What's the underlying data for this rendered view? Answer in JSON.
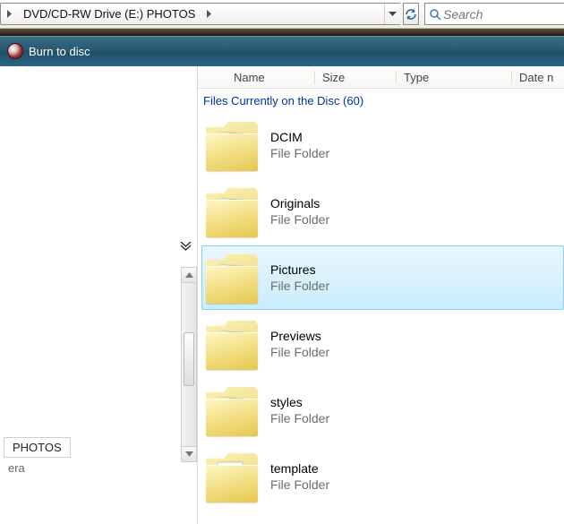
{
  "addressbar": {
    "path_segment": "DVD/CD-RW Drive (E:) PHOTOS"
  },
  "search": {
    "placeholder": "Search"
  },
  "commandbar": {
    "burn_label": "Burn to disc"
  },
  "columns": {
    "name": "Name",
    "size": "Size",
    "type": "Type",
    "date": "Date n"
  },
  "group_header": "Files Currently on the Disc (60)",
  "folder_type_label": "File Folder",
  "folders": [
    {
      "name": "DCIM",
      "selected": false,
      "icon": "photo"
    },
    {
      "name": "Originals",
      "selected": false,
      "icon": "photo"
    },
    {
      "name": "Pictures",
      "selected": true,
      "icon": "photo"
    },
    {
      "name": "Previews",
      "selected": false,
      "icon": "photo"
    },
    {
      "name": "styles",
      "selected": false,
      "icon": "photo"
    },
    {
      "name": "template",
      "selected": false,
      "icon": "empty"
    }
  ],
  "nav": {
    "photos_item": "PHOTOS",
    "era_item": "era"
  }
}
